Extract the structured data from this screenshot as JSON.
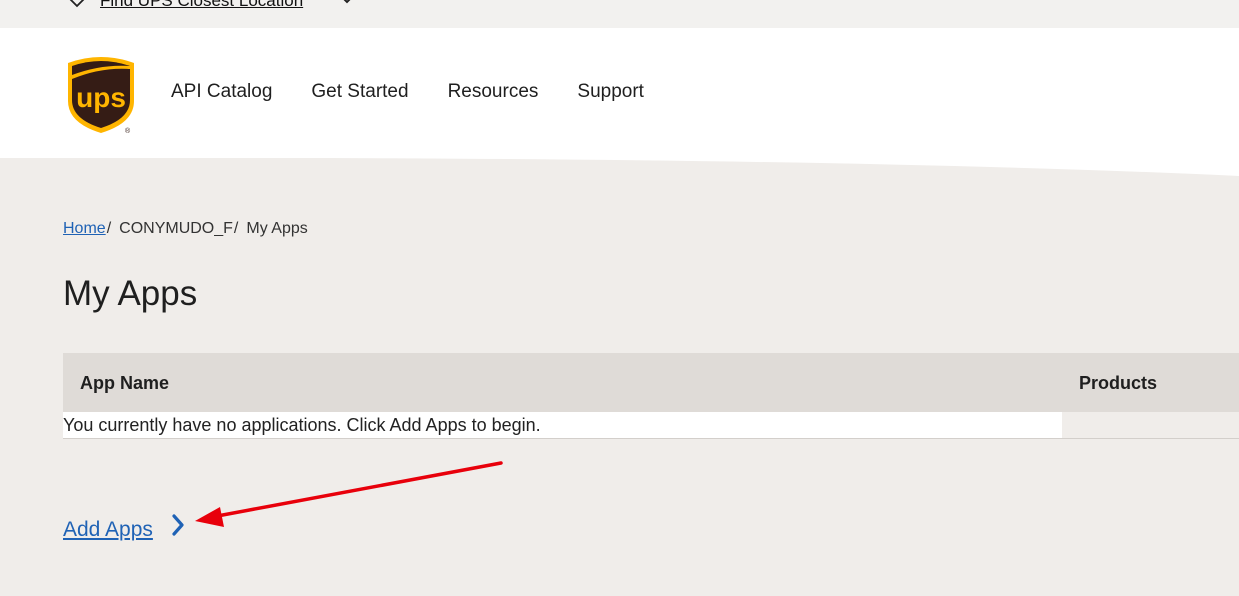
{
  "topbar": {
    "location_link": "Find UPS Closest Location",
    "location_icon": "map-pin-icon",
    "dropdown_icon": "chevron-down-icon"
  },
  "brand": {
    "logo_text": "ups",
    "logo_colors": {
      "shield": "#351c15",
      "accent": "#ffb500"
    }
  },
  "nav": {
    "items": [
      {
        "label": "API Catalog"
      },
      {
        "label": "Get Started"
      },
      {
        "label": "Resources"
      },
      {
        "label": "Support"
      }
    ]
  },
  "breadcrumb": {
    "home": "Home",
    "separator": "/",
    "account": "CONYMUDO_F",
    "current": "My Apps"
  },
  "page": {
    "title": "My Apps"
  },
  "apps_table": {
    "columns": [
      "App Name",
      "Products"
    ],
    "empty_message": "You currently have no applications. Click Add Apps to begin."
  },
  "actions": {
    "add_apps_label": "Add Apps",
    "add_apps_icon": "chevron-right-icon"
  },
  "annotation": {
    "arrow_color": "#e8000b",
    "arrow_icon": "red-arrow-icon"
  },
  "colors": {
    "link": "#1f62b5",
    "page_bg": "#f0edea",
    "table_header_bg": "#dfdbd7"
  }
}
